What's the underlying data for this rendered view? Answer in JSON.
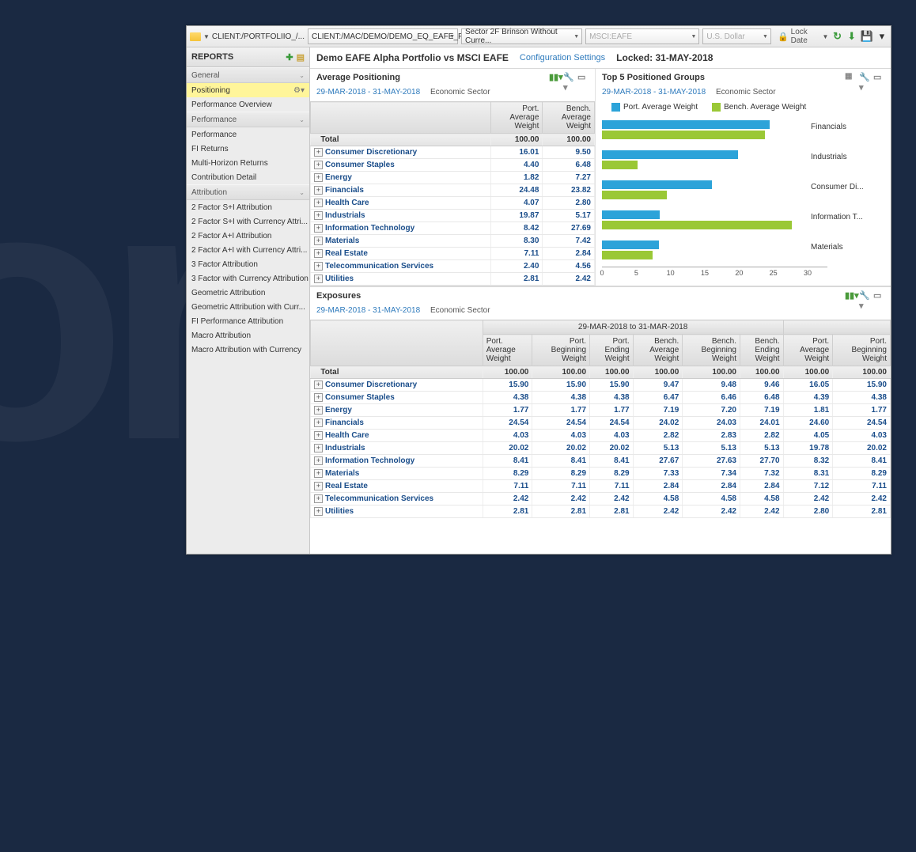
{
  "toolbar": {
    "crumb": "CLIENT:/PORTFOLIIO_/...",
    "dd1": "CLIENT:/MAC/DEMO/DEMO_EQ_EAFE_F...",
    "dd2": "Sector 2F Brinson Without Curre...",
    "dd3": "MSCI:EAFE",
    "dd4": "U.S. Dollar",
    "lock": "Lock Date"
  },
  "sidebar": {
    "title": "REPORTS",
    "groups": [
      {
        "label": "General",
        "items": []
      },
      {
        "label": "",
        "items": [
          {
            "label": "Positioning",
            "active": true
          },
          {
            "label": "Performance Overview"
          }
        ]
      },
      {
        "label": "Performance",
        "items": [
          {
            "label": "Performance"
          },
          {
            "label": "FI Returns"
          },
          {
            "label": "Multi-Horizon Returns"
          },
          {
            "label": "Contribution Detail"
          }
        ]
      },
      {
        "label": "Attribution",
        "items": [
          {
            "label": "2 Factor S+I Attribution"
          },
          {
            "label": "2 Factor S+I with Currency Attri..."
          },
          {
            "label": "2 Factor A+I Attribution"
          },
          {
            "label": "2 Factor A+I with Currency Attri..."
          },
          {
            "label": "3 Factor Attribution"
          },
          {
            "label": "3 Factor with Currency Attribution"
          },
          {
            "label": "Geometric Attribution"
          },
          {
            "label": "Geometric Attribution with Curr..."
          },
          {
            "label": "FI Performance Attribution"
          },
          {
            "label": "Macro Attribution"
          },
          {
            "label": "Macro Attribution with Currency"
          }
        ]
      }
    ]
  },
  "header": {
    "title": "Demo EAFE Alpha Portfolio vs MSCI EAFE",
    "config": "Configuration Settings",
    "locked": "Locked: 31-MAY-2018"
  },
  "avg_positioning": {
    "title": "Average Positioning",
    "date": "29-MAR-2018 - 31-MAY-2018",
    "sector": "Economic Sector",
    "cols": [
      "",
      "Port. Average Weight",
      "Bench. Average Weight"
    ],
    "total": [
      "Total",
      "100.00",
      "100.00"
    ],
    "rows": [
      [
        "Consumer Discretionary",
        "16.01",
        "9.50"
      ],
      [
        "Consumer Staples",
        "4.40",
        "6.48"
      ],
      [
        "Energy",
        "1.82",
        "7.27"
      ],
      [
        "Financials",
        "24.48",
        "23.82"
      ],
      [
        "Health Care",
        "4.07",
        "2.80"
      ],
      [
        "Industrials",
        "19.87",
        "5.17"
      ],
      [
        "Information Technology",
        "8.42",
        "27.69"
      ],
      [
        "Materials",
        "8.30",
        "7.42"
      ],
      [
        "Real Estate",
        "7.11",
        "2.84"
      ],
      [
        "Telecommunication Services",
        "2.40",
        "4.56"
      ],
      [
        "Utilities",
        "2.81",
        "2.42"
      ]
    ]
  },
  "top5": {
    "title": "Top 5 Positioned Groups",
    "date": "29-MAR-2018 - 31-MAY-2018",
    "sector": "Economic Sector",
    "legend": [
      "Port. Average Weight",
      "Bench. Average Weight"
    ]
  },
  "exposures": {
    "title": "Exposures",
    "date": "29-MAR-2018 - 31-MAY-2018",
    "sector": "Economic Sector",
    "period1": "29-MAR-2018 to 31-MAR-2018",
    "cols": [
      "",
      "Port. Average Weight",
      "Port. Beginning Weight",
      "Port. Ending Weight",
      "Bench. Average Weight",
      "Bench. Beginning Weight",
      "Bench. Ending Weight",
      "Port. Average Weight",
      "Port. Beginning Weight"
    ],
    "total": [
      "Total",
      "100.00",
      "100.00",
      "100.00",
      "100.00",
      "100.00",
      "100.00",
      "100.00",
      "100.00"
    ],
    "rows": [
      [
        "Consumer Discretionary",
        "15.90",
        "15.90",
        "15.90",
        "9.47",
        "9.48",
        "9.46",
        "16.05",
        "15.90"
      ],
      [
        "Consumer Staples",
        "4.38",
        "4.38",
        "4.38",
        "6.47",
        "6.46",
        "6.48",
        "4.39",
        "4.38"
      ],
      [
        "Energy",
        "1.77",
        "1.77",
        "1.77",
        "7.19",
        "7.20",
        "7.19",
        "1.81",
        "1.77"
      ],
      [
        "Financials",
        "24.54",
        "24.54",
        "24.54",
        "24.02",
        "24.03",
        "24.01",
        "24.60",
        "24.54"
      ],
      [
        "Health Care",
        "4.03",
        "4.03",
        "4.03",
        "2.82",
        "2.83",
        "2.82",
        "4.05",
        "4.03"
      ],
      [
        "Industrials",
        "20.02",
        "20.02",
        "20.02",
        "5.13",
        "5.13",
        "5.13",
        "19.78",
        "20.02"
      ],
      [
        "Information Technology",
        "8.41",
        "8.41",
        "8.41",
        "27.67",
        "27.63",
        "27.70",
        "8.32",
        "8.41"
      ],
      [
        "Materials",
        "8.29",
        "8.29",
        "8.29",
        "7.33",
        "7.34",
        "7.32",
        "8.31",
        "8.29"
      ],
      [
        "Real Estate",
        "7.11",
        "7.11",
        "7.11",
        "2.84",
        "2.84",
        "2.84",
        "7.12",
        "7.11"
      ],
      [
        "Telecommunication Services",
        "2.42",
        "2.42",
        "2.42",
        "4.58",
        "4.58",
        "4.58",
        "2.42",
        "2.42"
      ],
      [
        "Utilities",
        "2.81",
        "2.81",
        "2.81",
        "2.42",
        "2.42",
        "2.42",
        "2.80",
        "2.81"
      ]
    ]
  },
  "chart_data": {
    "type": "bar",
    "orientation": "horizontal",
    "categories": [
      "Financials",
      "Industrials",
      "Consumer Di...",
      "Information T...",
      "Materials"
    ],
    "series": [
      {
        "name": "Port. Average Weight",
        "values": [
          24.48,
          19.87,
          16.01,
          8.42,
          8.3
        ]
      },
      {
        "name": "Bench. Average Weight",
        "values": [
          23.82,
          5.17,
          9.5,
          27.69,
          7.42
        ]
      }
    ],
    "xlim": [
      0,
      30
    ],
    "ticks": [
      0,
      5,
      10,
      15,
      20,
      25,
      30
    ],
    "title": "Top 5 Positioned Groups",
    "xlabel": "",
    "ylabel": ""
  }
}
